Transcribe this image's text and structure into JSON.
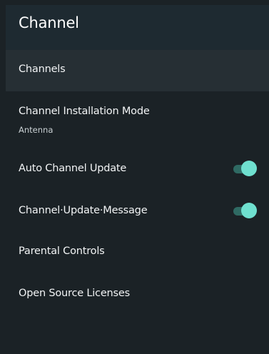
{
  "header": {
    "title": "Channel"
  },
  "menu": {
    "items": [
      {
        "label": "Channels"
      },
      {
        "label": "Channel Installation Mode",
        "value": "Antenna"
      },
      {
        "label": "Auto Channel Update",
        "toggle_on": true
      },
      {
        "label": "Channel·Update·Message",
        "toggle_on": true
      },
      {
        "label": "Parental Controls"
      },
      {
        "label": "Open Source Licenses"
      }
    ]
  },
  "colors": {
    "background": "#1b2226",
    "header": "#1e2a31",
    "focused_row": "#262f34",
    "toggle_thumb": "#6fe0cf",
    "toggle_track": "#2f6a63"
  }
}
